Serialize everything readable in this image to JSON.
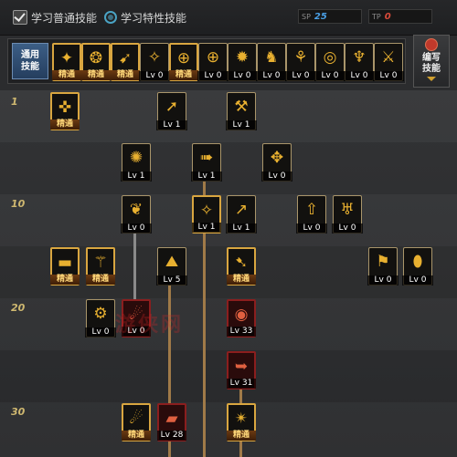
{
  "header": {
    "learn_normal": "学习普通技能",
    "learn_special": "学习特性技能",
    "sp_label": "SP",
    "sp_value": "25",
    "tp_label": "TP",
    "tp_value": "0"
  },
  "general": {
    "label_top": "通用",
    "label_bottom": "技能",
    "skills": [
      {
        "name": "general-skill-1",
        "cap": "精通",
        "icon": "✦",
        "mastered": true
      },
      {
        "name": "general-skill-2",
        "cap": "精通",
        "icon": "❂",
        "mastered": true
      },
      {
        "name": "general-skill-3",
        "cap": "精通",
        "icon": "➹",
        "mastered": true
      },
      {
        "name": "general-skill-4",
        "cap": "Lv 0",
        "icon": "✧",
        "mastered": false
      },
      {
        "name": "general-skill-5",
        "cap": "精通",
        "icon": "⊕",
        "mastered": true
      },
      {
        "name": "general-skill-6",
        "cap": "Lv 0",
        "icon": "⊕",
        "mastered": false
      },
      {
        "name": "general-skill-7",
        "cap": "Lv 0",
        "icon": "✹",
        "mastered": false
      },
      {
        "name": "general-skill-8",
        "cap": "Lv 0",
        "icon": "♞",
        "mastered": false
      },
      {
        "name": "general-skill-9",
        "cap": "Lv 0",
        "icon": "⚘",
        "mastered": false
      },
      {
        "name": "general-skill-10",
        "cap": "Lv 0",
        "icon": "◎",
        "mastered": false
      },
      {
        "name": "general-skill-11",
        "cap": "Lv 0",
        "icon": "♆",
        "mastered": false
      },
      {
        "name": "general-skill-12",
        "cap": "Lv 0",
        "icon": "⚔",
        "mastered": false
      }
    ],
    "macro_top": "编写",
    "macro_bottom": "技能"
  },
  "levels": [
    "1",
    "10",
    "20",
    "30"
  ],
  "skills": {
    "s01": {
      "cap": "精通",
      "icon": "✜"
    },
    "s02": {
      "cap": "Lv 1",
      "icon": "➚"
    },
    "s03": {
      "cap": "Lv 1",
      "icon": "⚒"
    },
    "s04": {
      "cap": "Lv 1",
      "icon": "✺"
    },
    "s05": {
      "cap": "Lv 1",
      "icon": "➠"
    },
    "s06": {
      "cap": "Lv 0",
      "icon": "✥"
    },
    "s07": {
      "cap": "Lv 0",
      "icon": "❦"
    },
    "s08": {
      "cap": "Lv 1",
      "icon": "✧"
    },
    "s09": {
      "cap": "Lv 1",
      "icon": "↗"
    },
    "s10": {
      "cap": "Lv 0",
      "icon": "⇧"
    },
    "s11": {
      "cap": "Lv 0",
      "icon": "♅"
    },
    "s12": {
      "cap": "精通",
      "icon": "▬"
    },
    "s13": {
      "cap": "精通",
      "icon": "⚚"
    },
    "s14": {
      "cap": "Lv 5",
      "icon": "⛰"
    },
    "s15": {
      "cap": "精通",
      "icon": "➷"
    },
    "s16": {
      "cap": "Lv 0",
      "icon": "⚑"
    },
    "s17": {
      "cap": "Lv 0",
      "icon": "⬮"
    },
    "s18": {
      "cap": "Lv 0",
      "icon": "⚙"
    },
    "s19": {
      "cap": "Lv 0",
      "icon": "☄"
    },
    "s20": {
      "cap": "Lv 33",
      "icon": "◉"
    },
    "s21": {
      "cap": "Lv 31",
      "icon": "➥"
    },
    "s22": {
      "cap": "精通",
      "icon": "☄"
    },
    "s23": {
      "cap": "Lv 28",
      "icon": "▰"
    },
    "s24": {
      "cap": "精通",
      "icon": "✴"
    }
  },
  "watermark": "游侠网"
}
